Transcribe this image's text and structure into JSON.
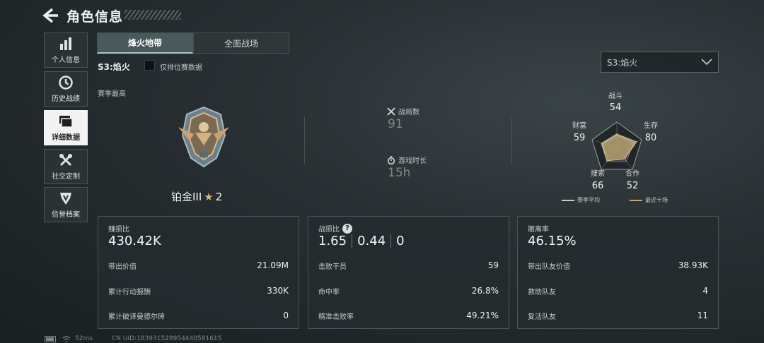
{
  "header": {
    "title": "角色信息"
  },
  "sidebar": {
    "items": [
      {
        "label": "个人信息",
        "icon": "bar-chart-icon",
        "active": false
      },
      {
        "label": "历史战绩",
        "icon": "clock-icon",
        "active": false
      },
      {
        "label": "详细数据",
        "icon": "cards-icon",
        "active": true
      },
      {
        "label": "社交定制",
        "icon": "tools-icon",
        "active": false
      },
      {
        "label": "信誉档案",
        "icon": "shield-icon",
        "active": false
      }
    ]
  },
  "tabs": [
    {
      "label": "烽火地带",
      "active": true
    },
    {
      "label": "全面战场",
      "active": false
    }
  ],
  "filter": {
    "season_label": "S3:焰火",
    "ranked_only_label": "仅排位赛数据",
    "ranked_only_checked": false,
    "season_select": "S3:焰火"
  },
  "season_best": {
    "label": "赛季最高",
    "rank_name": "铂金III",
    "rank_stars": "2",
    "rank_icon": "platinum-eagle-badge-icon"
  },
  "overview": {
    "matches_label": "战局数",
    "matches_value": "91",
    "playtime_label": "游戏时长",
    "playtime_value": "15h"
  },
  "radar": {
    "axes": [
      {
        "label": "战斗",
        "value": "54"
      },
      {
        "label": "生存",
        "value": "80"
      },
      {
        "label": "合作",
        "value": "52"
      },
      {
        "label": "搜索",
        "value": "66"
      },
      {
        "label": "财富",
        "value": "59"
      }
    ],
    "legend_season_avg": "赛季平均",
    "legend_recent": "最近十场",
    "colors": {
      "season_avg": "#c8cccc",
      "recent": "#c2ab72"
    }
  },
  "panels": {
    "profit": {
      "title": "赚损比",
      "value": "430.42K",
      "rows": [
        {
          "k": "带出价值",
          "v": "21.09M"
        },
        {
          "k": "累计行动报酬",
          "v": "330K"
        },
        {
          "k": "累计破译曼德尔砖",
          "v": "0"
        }
      ]
    },
    "combat": {
      "title": "战损比",
      "values": [
        "1.65",
        "0.44",
        "0"
      ],
      "rows": [
        {
          "k": "击败干员",
          "v": "59"
        },
        {
          "k": "命中率",
          "v": "26.8%"
        },
        {
          "k": "精准击败率",
          "v": "49.21%"
        }
      ]
    },
    "extract": {
      "title": "撤离率",
      "value": "46.15%",
      "rows": [
        {
          "k": "带出队友价值",
          "v": "38.93K"
        },
        {
          "k": "救助队友",
          "v": "4"
        },
        {
          "k": "复活队友",
          "v": "11"
        }
      ]
    }
  },
  "footer": {
    "ping": "52ms",
    "uid": "CN UID:183931528954440581615"
  }
}
